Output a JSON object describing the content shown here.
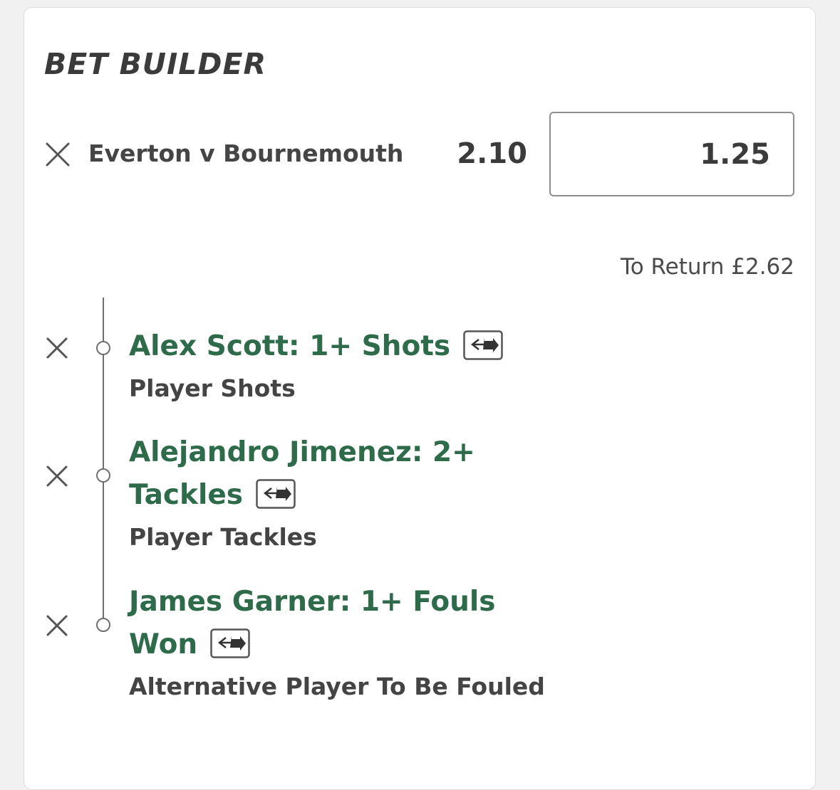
{
  "card": {
    "title": "BET BUILDER"
  },
  "event": {
    "name": "Everton v Bournemouth",
    "odds": "2.10",
    "stake": "1.25",
    "to_return": "To Return £2.62"
  },
  "selections": [
    {
      "title_line1": "Alex Scott: 1+ Shots",
      "title_line2": "",
      "market": "Player Shots"
    },
    {
      "title_line1": "Alejandro Jimenez: 2+",
      "title_line2": "Tackles",
      "market": "Player Tackles"
    },
    {
      "title_line1": "James Garner: 1+ Fouls",
      "title_line2": "Won",
      "market": "Alternative Player To Be Fouled"
    }
  ],
  "icons": {
    "remove": "close-icon",
    "swap": "swap-icon",
    "node": "timeline-node-icon"
  },
  "colors": {
    "selection_green": "#2e6b4a",
    "text_dark": "#3b3b3b",
    "background": "#f1f1f1"
  }
}
